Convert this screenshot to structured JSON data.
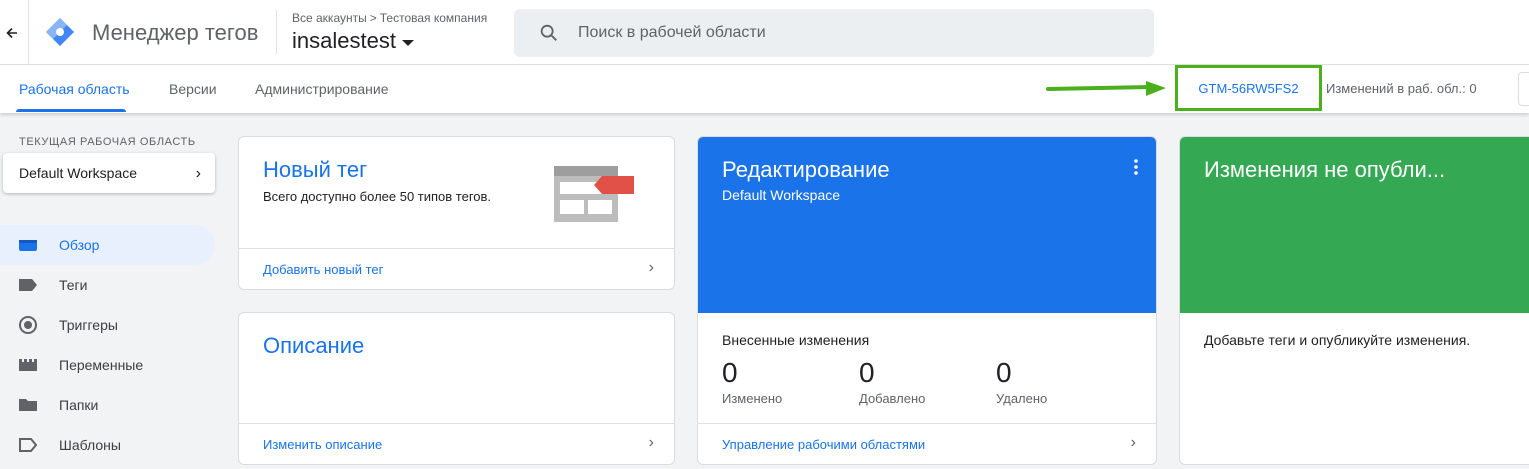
{
  "header": {
    "back_icon": "arrow-left-icon",
    "logo_icon": "gtm-diamond-logo",
    "app_title": "Менеджер тегов",
    "breadcrumb": {
      "account": "Все аккаунты",
      "separator": ">",
      "company": "Тестовая компания"
    },
    "container_name": "insalestest",
    "search_placeholder": "Поиск в рабочей области"
  },
  "tabs": [
    {
      "label": "Рабочая область",
      "active": true
    },
    {
      "label": "Версии",
      "active": false
    },
    {
      "label": "Администрирование",
      "active": false
    }
  ],
  "container_id": "GTM-56RW5FS2",
  "workspace_changes": "Изменений в раб. обл.: 0",
  "highlight_color": "#4caf1c",
  "sidebar": {
    "section_label": "ТЕКУЩАЯ РАБОЧАЯ ОБЛАСТЬ",
    "workspace_name": "Default Workspace",
    "items": [
      {
        "label": "Обзор",
        "icon": "overview-icon",
        "active": true
      },
      {
        "label": "Теги",
        "icon": "tag-icon",
        "active": false
      },
      {
        "label": "Триггеры",
        "icon": "trigger-icon",
        "active": false
      },
      {
        "label": "Переменные",
        "icon": "variables-icon",
        "active": false
      },
      {
        "label": "Папки",
        "icon": "folder-icon",
        "active": false
      },
      {
        "label": "Шаблоны",
        "icon": "template-icon",
        "active": false
      }
    ]
  },
  "cards": {
    "new_tag": {
      "title": "Новый тег",
      "description": "Всего доступно более 50 типов тегов.",
      "link": "Добавить новый тег"
    },
    "description": {
      "title": "Описание",
      "link": "Изменить описание"
    },
    "editing": {
      "title": "Редактирование",
      "subtitle": "Default Workspace",
      "stats_title": "Внесенные изменения",
      "stats": [
        {
          "value": "0",
          "label": "Изменено"
        },
        {
          "value": "0",
          "label": "Добавлено"
        },
        {
          "value": "0",
          "label": "Удалено"
        }
      ],
      "link": "Управление рабочими областями"
    },
    "unpublished": {
      "title": "Изменения не опубли...",
      "body": "Добавьте теги и опубликуйте изменения."
    }
  },
  "colors": {
    "accent": "#1a73e8",
    "editing_bg": "#1a73e8",
    "unpublished_bg": "#34a853"
  }
}
